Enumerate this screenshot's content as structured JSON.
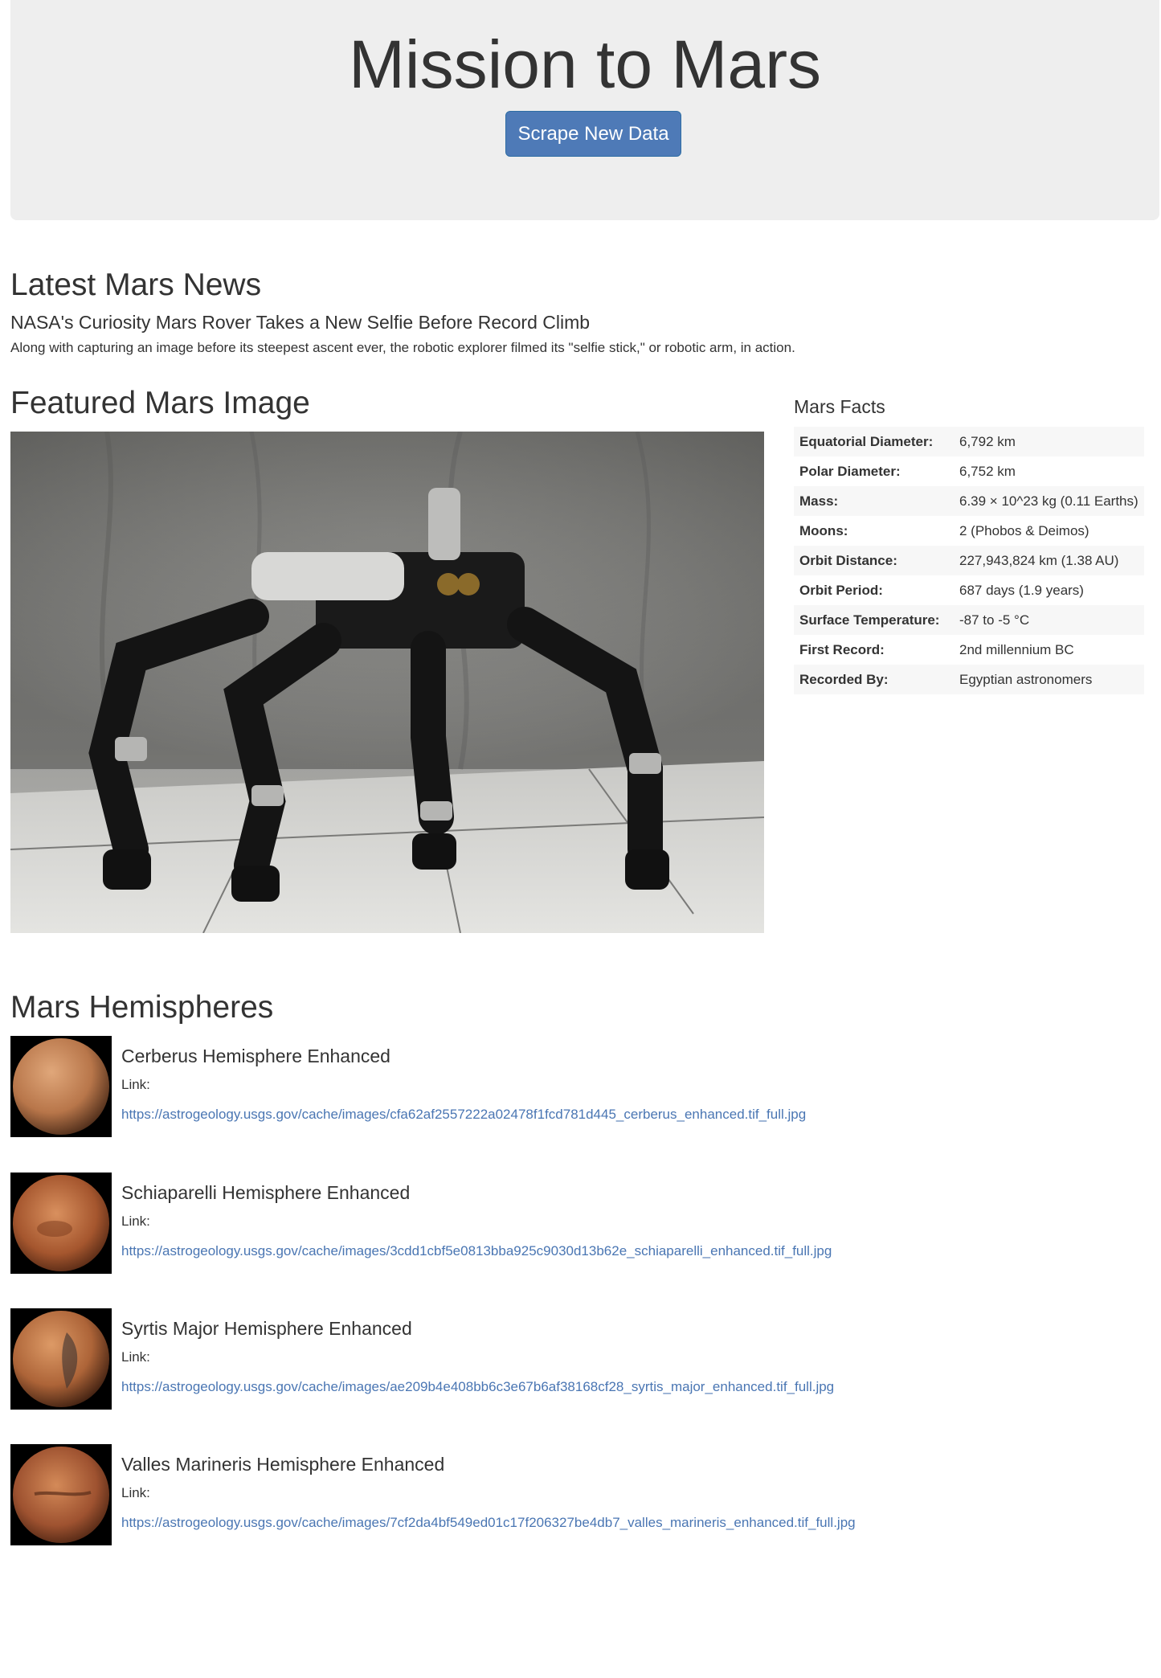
{
  "header": {
    "title": "Mission to Mars",
    "scrape_button": "Scrape New Data"
  },
  "news": {
    "heading": "Latest Mars News",
    "title": "NASA's Curiosity Mars Rover Takes a New Selfie Before Record Climb",
    "paragraph": "Along with capturing an image before its steepest ascent ever, the robotic explorer filmed its \"selfie stick,\" or robotic arm, in action."
  },
  "featured": {
    "heading": "Featured Mars Image",
    "image_alt": "robot-photo"
  },
  "facts": {
    "heading": "Mars Facts",
    "rows": [
      {
        "label": "Equatorial Diameter:",
        "value": "6,792 km"
      },
      {
        "label": "Polar Diameter:",
        "value": "6,752 km"
      },
      {
        "label": "Mass:",
        "value": "6.39 × 10^23 kg (0.11 Earths)"
      },
      {
        "label": "Moons:",
        "value": "2 (Phobos & Deimos)"
      },
      {
        "label": "Orbit Distance:",
        "value": "227,943,824 km (1.38 AU)"
      },
      {
        "label": "Orbit Period:",
        "value": "687 days (1.9 years)"
      },
      {
        "label": "Surface Temperature:",
        "value": "-87 to -5 °C"
      },
      {
        "label": "First Record:",
        "value": "2nd millennium BC"
      },
      {
        "label": "Recorded By:",
        "value": "Egyptian astronomers"
      }
    ]
  },
  "hemispheres": {
    "heading": "Mars Hemispheres",
    "link_label": "Link:",
    "items": [
      {
        "title": "Cerberus Hemisphere Enhanced",
        "url": "https://astrogeology.usgs.gov/cache/images/cfa62af2557222a02478f1fcd781d445_cerberus_enhanced.tif_full.jpg"
      },
      {
        "title": "Schiaparelli Hemisphere Enhanced",
        "url": "https://astrogeology.usgs.gov/cache/images/3cdd1cbf5e0813bba925c9030d13b62e_schiaparelli_enhanced.tif_full.jpg"
      },
      {
        "title": "Syrtis Major Hemisphere Enhanced",
        "url": "https://astrogeology.usgs.gov/cache/images/ae209b4e408bb6c3e67b6af38168cf28_syrtis_major_enhanced.tif_full.jpg"
      },
      {
        "title": "Valles Marineris Hemisphere Enhanced",
        "url": "https://astrogeology.usgs.gov/cache/images/7cf2da4bf549ed01c17f206327be4db7_valles_marineris_enhanced.tif_full.jpg"
      }
    ]
  },
  "colors": {
    "button_bg": "#4e7ab7",
    "link": "#4a76b3",
    "jumbotron_bg": "#eeeeee"
  }
}
